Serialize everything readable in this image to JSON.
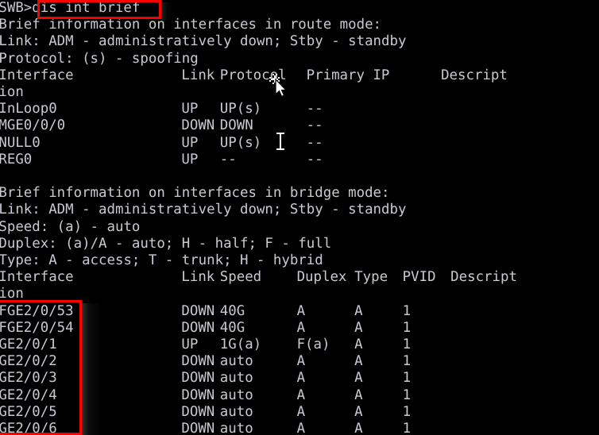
{
  "terminal": {
    "background_color": "#000000",
    "text_color": "#c9c9d2",
    "annotation_color": "#ff0000",
    "prompt": "<SWB>",
    "command": "dis int brief"
  },
  "route_section": {
    "heading": "Brief information on interfaces in route mode:",
    "legend_link": "Link: ADM - administratively down; Stby - standby",
    "legend_protocol": "Protocol: (s) - spoofing",
    "header": {
      "interface": "Interface",
      "link": "Link",
      "protocol": "Protocol",
      "primary_ip": "Primary IP",
      "description": "Descript",
      "description_wrap": "ion"
    },
    "rows": [
      {
        "interface": "InLoop0",
        "link": "UP",
        "protocol": "UP(s)",
        "primary_ip": "--",
        "description": ""
      },
      {
        "interface": "MGE0/0/0",
        "link": "DOWN",
        "protocol": "DOWN",
        "primary_ip": "--",
        "description": ""
      },
      {
        "interface": "NULL0",
        "link": "UP",
        "protocol": "UP(s)",
        "primary_ip": "--",
        "description": ""
      },
      {
        "interface": "REG0",
        "link": "UP",
        "protocol": "--",
        "primary_ip": "--",
        "description": ""
      }
    ]
  },
  "bridge_section": {
    "heading": "Brief information on interfaces in bridge mode:",
    "legend_link": "Link: ADM - administratively down; Stby - standby",
    "legend_speed": "Speed: (a) - auto",
    "legend_duplex": "Duplex: (a)/A - auto; H - half; F - full",
    "legend_type": "Type: A - access; T - trunk; H - hybrid",
    "header": {
      "interface": "Interface",
      "link": "Link",
      "speed": "Speed",
      "duplex": "Duplex",
      "type": "Type",
      "pvid": "PVID",
      "description": "Descript",
      "description_wrap": "ion"
    },
    "rows": [
      {
        "interface": "FGE2/0/53",
        "link": "DOWN",
        "speed": "40G",
        "duplex": "A",
        "type": "A",
        "pvid": "1"
      },
      {
        "interface": "FGE2/0/54",
        "link": "DOWN",
        "speed": "40G",
        "duplex": "A",
        "type": "A",
        "pvid": "1"
      },
      {
        "interface": "GE2/0/1",
        "link": "UP",
        "speed": "1G(a)",
        "duplex": "F(a)",
        "type": "A",
        "pvid": "1"
      },
      {
        "interface": "GE2/0/2",
        "link": "DOWN",
        "speed": "auto",
        "duplex": "A",
        "type": "A",
        "pvid": "1"
      },
      {
        "interface": "GE2/0/3",
        "link": "DOWN",
        "speed": "auto",
        "duplex": "A",
        "type": "A",
        "pvid": "1"
      },
      {
        "interface": "GE2/0/4",
        "link": "DOWN",
        "speed": "auto",
        "duplex": "A",
        "type": "A",
        "pvid": "1"
      },
      {
        "interface": "GE2/0/5",
        "link": "DOWN",
        "speed": "auto",
        "duplex": "A",
        "type": "A",
        "pvid": "1"
      },
      {
        "interface": "GE2/0/6",
        "link": "DOWN",
        "speed": "auto",
        "duplex": "A",
        "type": "A",
        "pvid": "1"
      }
    ]
  },
  "annotations": [
    {
      "name": "command-highlight",
      "target": "dis int brief"
    },
    {
      "name": "interface-column-highlight",
      "target": "bridge interface names"
    }
  ],
  "cursors": {
    "mouse_pointer": "arrow-move-cursor",
    "text_caret": "i-beam-cursor"
  }
}
